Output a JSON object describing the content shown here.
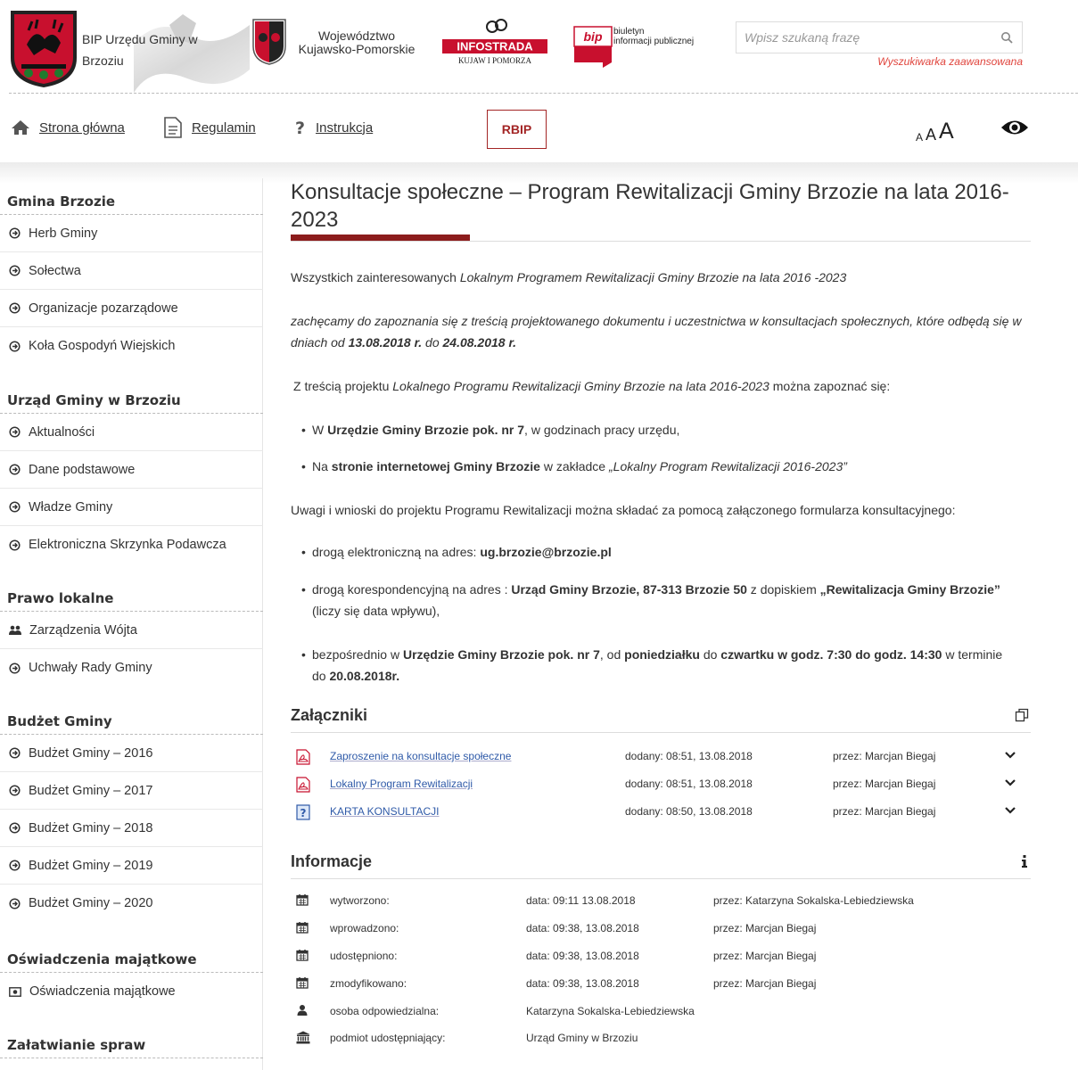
{
  "header": {
    "site_name": "BIP Urzędu Gminy w Brzoziu",
    "voivodeship": "Województwo Kujawsko-Pomorskie",
    "infostrada_text": "INFOSTRADA",
    "infostrada_sub": "KUJAW I POMORZA",
    "bip_logo_text": "bip",
    "bip_subtitle_1": "biuletyn",
    "bip_subtitle_2": "informacji publicznej",
    "search_placeholder": "Wpisz szukaną frazę",
    "advanced_search": "Wyszukiwarka zaawansowana"
  },
  "nav": {
    "home": "Strona główna",
    "rules": "Regulamin",
    "help": "Instrukcja",
    "rbip": "RBIP",
    "font_small": "A",
    "font_medium": "A",
    "font_large": "A"
  },
  "sidebar": {
    "sections": [
      {
        "title": "Gmina Brzozie",
        "items": [
          "Herb Gminy",
          "Sołectwa",
          "Organizacje pozarządowe",
          "Koła Gospodyń Wiejskich"
        ]
      },
      {
        "title": "Urząd Gminy w Brzoziu",
        "items": [
          "Aktualności",
          "Dane podstawowe",
          "Władze Gminy",
          "Elektroniczna Skrzynka Podawcza"
        ]
      },
      {
        "title": "Prawo lokalne",
        "items": [
          "Zarządzenia Wójta",
          "Uchwały Rady Gminy"
        ]
      },
      {
        "title": "Budżet Gminy",
        "items": [
          "Budżet Gminy – 2016",
          "Budżet Gminy – 2017",
          "Budżet Gminy – 2018",
          "Budżet Gminy – 2019",
          "Budżet Gminy – 2020"
        ]
      },
      {
        "title": "Oświadczenia majątkowe",
        "items": [
          "Oświadczenia majątkowe"
        ]
      },
      {
        "title": "Załatwianie spraw",
        "items": []
      }
    ]
  },
  "article": {
    "title": "Konsultacje społeczne – Program Rewitalizacji Gminy Brzozie na lata 2016-2023",
    "p1_a": "Wszystkich zainteresowanych ",
    "p1_b": "Lokalnym Programem Rewitalizacji Gminy Brzozie na lata 2016 -2023",
    "p2_a": "zachęcamy do zapoznania się z treścią projektowanego dokumentu i uczestnictwa w konsultacjach społecznych, które odbędą się w dniach od ",
    "p2_b": "13.08.2018 r.",
    "p2_c": " do ",
    "p2_d": "24.08.2018 r.",
    "p3_a": "Z treścią projektu ",
    "p3_b": "Lokalnego Programu Rewitalizacji Gminy Brzozie na lata 2016-2023",
    "p3_c": " można zapoznać się:",
    "b1_a": "W ",
    "b1_b": "Urzędzie Gminy Brzozie pok. nr 7",
    "b1_c": ", w godzinach pracy urzędu,",
    "b2_a": "Na ",
    "b2_b": "stronie internetowej Gminy Brzozie",
    "b2_c": " w zakładce ",
    "b2_d": "„Lokalny Program Rewitalizacji 2016-2023”",
    "p4": "Uwagi i wnioski do projektu Programu Rewitalizacji można składać za pomocą załączonego formularza konsultacyjnego:",
    "c1_a": "drogą elektroniczną na adres: ",
    "c1_b": "ug.brzozie@brzozie.pl",
    "c2_a": "drogą korespondencyjną na adres : ",
    "c2_b": "Urząd Gminy Brzozie, 87-313 Brzozie 50",
    "c2_c": " z dopiskiem ",
    "c2_d": "„Rewitalizacja Gminy Brzozie”",
    "c2_e": " (liczy się data wpływu),",
    "c3_a": "bezpośrednio w ",
    "c3_b": "Urzędzie Gminy Brzozie pok. nr 7",
    "c3_c": ", od ",
    "c3_d": "poniedziałku",
    "c3_e": " do ",
    "c3_f": "czwartku w godz. 7:30 do godz. 14:30",
    "c3_g": " w terminie do ",
    "c3_h": "20.08.2018r."
  },
  "attachments": {
    "title": "Załączniki",
    "rows": [
      {
        "name": "Zaproszenie na konsultacje społeczne",
        "date": "dodany: 08:51, 13.08.2018",
        "by": "przez: Marcjan Biegaj",
        "type": "pdf"
      },
      {
        "name": "Lokalny Program Rewitalizacji",
        "date": "dodany: 08:51, 13.08.2018",
        "by": "przez: Marcjan Biegaj",
        "type": "pdf"
      },
      {
        "name": "KARTA KONSULTACJI",
        "date": "dodany: 08:50, 13.08.2018",
        "by": "przez: Marcjan Biegaj",
        "type": "doc"
      }
    ]
  },
  "info": {
    "title": "Informacje",
    "rows": [
      {
        "label": "wytworzono:",
        "value": "data: 09:11 13.08.2018",
        "by": "przez: Katarzyna Sokalska-Lebiedziewska",
        "icon": "calendar-icon"
      },
      {
        "label": "wprowadzono:",
        "value": "data: 09:38, 13.08.2018",
        "by": "przez: Marcjan Biegaj",
        "icon": "calendar-icon"
      },
      {
        "label": "udostępniono:",
        "value": "data: 09:38, 13.08.2018",
        "by": "przez: Marcjan Biegaj",
        "icon": "calendar-icon"
      },
      {
        "label": "zmodyfikowano:",
        "value": "data: 09:38, 13.08.2018",
        "by": "przez: Marcjan Biegaj",
        "icon": "calendar-icon"
      },
      {
        "label": "osoba odpowiedzialna:",
        "value": "Katarzyna Sokalska-Lebiedziewska",
        "by": "",
        "icon": "user-icon"
      },
      {
        "label": "podmiot udostępniający:",
        "value": "Urząd Gminy w Brzoziu",
        "by": "",
        "icon": "institution-icon"
      }
    ]
  },
  "colors": {
    "accent": "#8c1c1c",
    "link": "#2f5aa8",
    "advanced_search": "#e0453d",
    "rbip": "#a32525"
  }
}
